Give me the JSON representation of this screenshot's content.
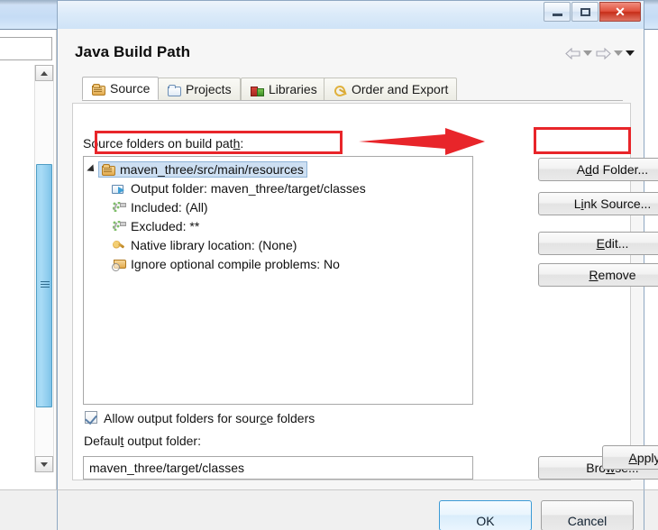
{
  "window": {
    "controls": {
      "minimize": "minimize-button",
      "maximize": "maximize-button",
      "close": "✕"
    }
  },
  "dialog": {
    "title": "Java Build Path",
    "nav": {
      "back": "back-arrow",
      "back_menu": "▼",
      "forward": "forward-arrow",
      "forward_menu": "▼",
      "more": "▼"
    },
    "tabs": [
      {
        "label": "Source",
        "icon": "source-folder-icon",
        "active": true
      },
      {
        "label": "Projects",
        "icon": "open-folder-icon",
        "active": false
      },
      {
        "label": "Libraries",
        "icon": "libraries-icon",
        "active": false
      },
      {
        "label": "Order and Export",
        "icon": "order-export-icon",
        "active": false
      }
    ],
    "source": {
      "tree_label": "Source folders on build path:",
      "tree": [
        {
          "label": "maven_three/src/main/resources",
          "icon": "source-folder-icon",
          "level": 0,
          "selected": true,
          "expanded": true
        },
        {
          "label": "Output folder: maven_three/target/classes",
          "icon": "output-folder-icon",
          "level": 1,
          "selected": false
        },
        {
          "label": "Included: (All)",
          "icon": "inclusion-filter-icon",
          "level": 1,
          "selected": false
        },
        {
          "label": "Excluded: **",
          "icon": "exclusion-filter-icon",
          "level": 1,
          "selected": false
        },
        {
          "label": "Native library location: (None)",
          "icon": "native-library-icon",
          "level": 1,
          "selected": false
        },
        {
          "label": "Ignore optional compile problems: No",
          "icon": "ignore-problems-icon",
          "level": 1,
          "selected": false
        }
      ],
      "buttons": [
        {
          "label": "Add Folder...",
          "mnemonic_index": 1,
          "highlighted": true
        },
        {
          "label": "Link Source...",
          "mnemonic_index": 1,
          "highlighted": false
        },
        {
          "label": "Edit...",
          "mnemonic_index": 0,
          "highlighted": false
        },
        {
          "label": "Remove",
          "mnemonic_index": 0,
          "highlighted": false
        }
      ],
      "allow_output_checkbox": {
        "label": "Allow output folders for source folders",
        "mnemonic_index": 26,
        "checked": true
      },
      "default_output_label": {
        "text": "Default output folder:",
        "mnemonic_index": 7
      },
      "default_output_value": "maven_three/target/classes",
      "browse_button": {
        "label": "Browse...",
        "mnemonic_index": 3
      }
    },
    "apply_button": {
      "label": "Apply",
      "mnemonic_index": 0
    },
    "ok_button": "OK",
    "cancel_button": "Cancel"
  },
  "annotations": {
    "accent_color": "#e8252a",
    "rect_tree_item": "highlight-selected-source-folder",
    "rect_add_folder": "highlight-add-folder-button",
    "arrow": "pointer-arrow-to-add-folder"
  }
}
